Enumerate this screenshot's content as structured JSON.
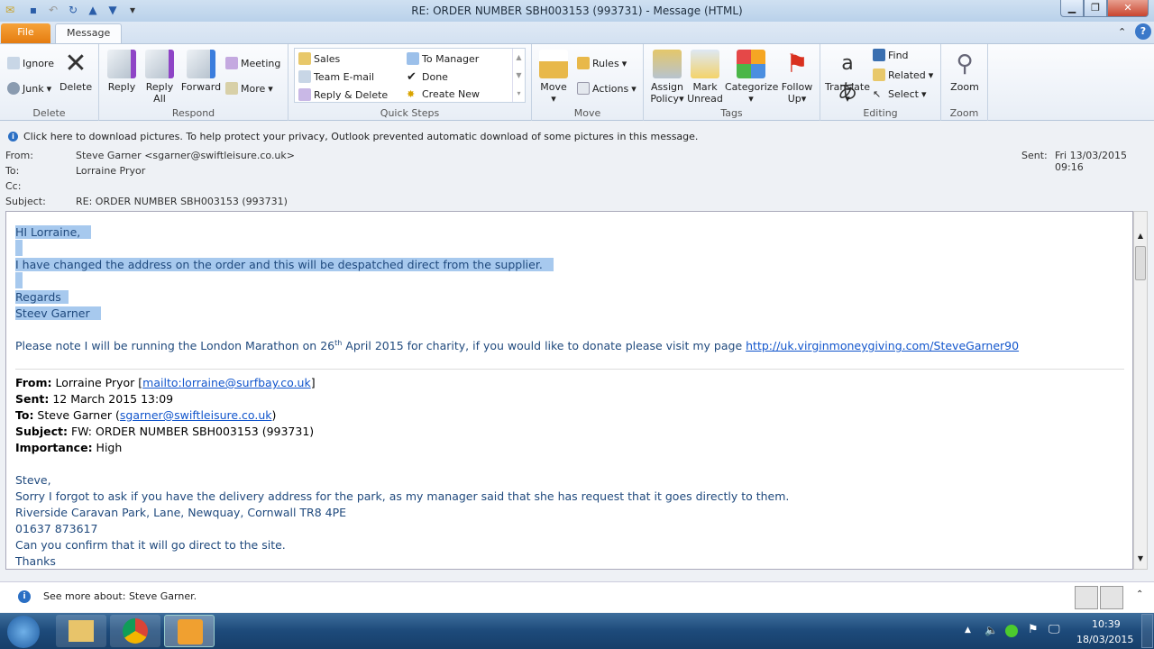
{
  "window": {
    "title": "RE: ORDER NUMBER SBH003153 (993731)  -  Message (HTML)"
  },
  "tabs": {
    "file": "File",
    "message": "Message"
  },
  "ribbon": {
    "delete": {
      "label": "Delete",
      "ignore": "Ignore",
      "junk": "Junk",
      "delete": "Delete"
    },
    "respond": {
      "label": "Respond",
      "reply": "Reply",
      "reply_all_1": "Reply",
      "reply_all_2": "All",
      "forward": "Forward",
      "meeting": "Meeting",
      "more": "More"
    },
    "quick_steps": {
      "label": "Quick Steps",
      "items": [
        "Sales",
        "Team E-mail",
        "Reply & Delete",
        "To Manager",
        "Done",
        "Create New"
      ]
    },
    "move": {
      "label": "Move",
      "move": "Move",
      "rules": "Rules",
      "actions": "Actions"
    },
    "tags": {
      "label": "Tags",
      "assign_1": "Assign",
      "assign_2": "Policy",
      "mark_1": "Mark",
      "mark_2": "Unread",
      "categorize": "Categorize",
      "follow_1": "Follow",
      "follow_2": "Up"
    },
    "editing": {
      "label": "Editing",
      "translate": "Translate",
      "find": "Find",
      "related": "Related",
      "select": "Select"
    },
    "zoom": {
      "label": "Zoom",
      "zoom": "Zoom"
    }
  },
  "infobar": "Click here to download pictures. To help protect your privacy, Outlook prevented automatic download of some pictures in this message.",
  "header": {
    "from_label": "From:",
    "from": "Steve Garner <sgarner@swiftleisure.co.uk>",
    "to_label": "To:",
    "to": "Lorraine Pryor",
    "cc_label": "Cc:",
    "subject_label": "Subject:",
    "subject": "RE: ORDER NUMBER SBH003153 (993731)",
    "sent_label": "Sent:",
    "sent": "Fri 13/03/2015 09:16"
  },
  "body": {
    "greeting": "HI Lorraine,",
    "line1": "I have changed the address on the order and this will be despatched direct from the supplier.",
    "regards": "Regards",
    "name": "Steev Garner",
    "note_a": "Please note I will be running the London Marathon on 26",
    "note_sup": "th",
    "note_b": " April 2015 for charity, if you would like to donate please visit my page ",
    "note_link": "http://uk.virginmoneygiving.com/SteveGarner90",
    "q_from_label": "From:",
    "q_from": " Lorraine Pryor [",
    "q_from_link": "mailto:lorraine@surfbay.co.uk",
    "q_from_end": "]",
    "q_sent_label": "Sent:",
    "q_sent": " 12 March 2015 13:09",
    "q_to_label": "To:",
    "q_to": " Steve Garner (",
    "q_to_link": "sgarner@swiftleisure.co.uk",
    "q_to_end": ")",
    "q_subject_label": "Subject:",
    "q_subject": " FW: ORDER NUMBER SBH003153 (993731)",
    "q_imp_label": "Importance:",
    "q_imp": " High",
    "q1": "Steve,",
    "q2": "Sorry I forgot to ask if you have the delivery address for the park, as my manager said that she has request that it goes directly to them.",
    "q3": "Riverside Caravan Park, Lane, Newquay, Cornwall TR8 4PE",
    "q4": "01637 873617",
    "q5": "Can you confirm that it will go direct to the site.",
    "q6": "Thanks"
  },
  "people_pane": "See more about: Steve Garner.",
  "taskbar": {
    "time": "10:39",
    "date": "18/03/2015"
  }
}
